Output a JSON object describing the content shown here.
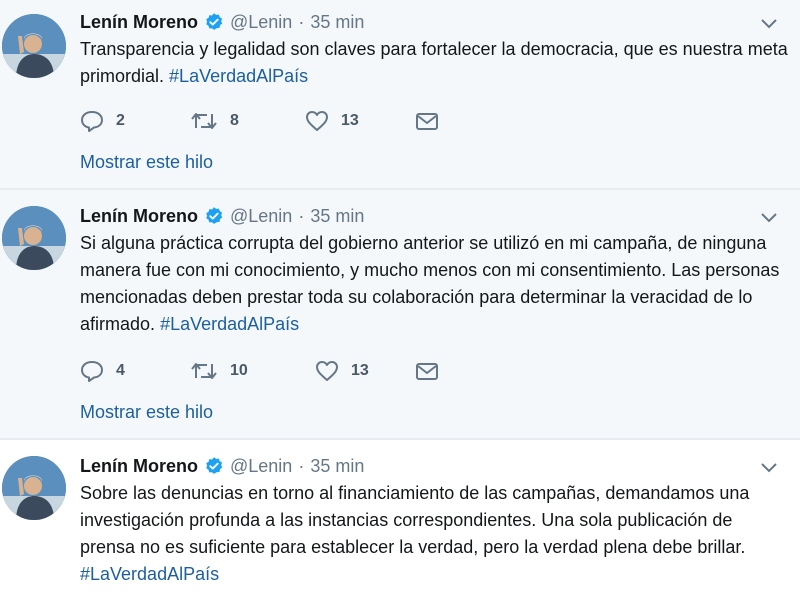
{
  "tweets": [
    {
      "name": "Lenín Moreno",
      "handle": "@Lenin",
      "separator": "·",
      "time": "35 min",
      "text": "Transparencia y legalidad son claves para fortalecer la democracia, que es nuestra meta primordial.",
      "hashtag": "#LaVerdadAlPaís",
      "replies": "2",
      "retweets": "8",
      "likes": "13",
      "thread_label": "Mostrar este hilo"
    },
    {
      "name": "Lenín Moreno",
      "handle": "@Lenin",
      "separator": "·",
      "time": "35 min",
      "text": "Si alguna práctica corrupta del gobierno anterior se utilizó en mi campaña, de ninguna manera fue con mi conocimiento, y mucho menos con mi consentimiento. Las personas mencionadas deben prestar toda su colaboración para determinar la veracidad de lo afirmado.",
      "hashtag": "#LaVerdadAlPaís",
      "replies": "4",
      "retweets": "10",
      "likes": "13",
      "thread_label": "Mostrar este hilo"
    },
    {
      "name": "Lenín Moreno",
      "handle": "@Lenin",
      "separator": "·",
      "time": "35 min",
      "text": "Sobre las denuncias en torno al financiamiento de las campañas, demandamos una investigación profunda a las instancias correspondientes. Una sola publicación de prensa no es suficiente para establecer la verdad, pero la verdad plena debe brillar.",
      "hashtag": "#LaVerdadAlPaís"
    }
  ],
  "icons": {
    "reply": "reply-icon",
    "retweet": "retweet-icon",
    "like": "heart-icon",
    "message": "envelope-icon",
    "verified": "verified-badge-icon",
    "menu": "chevron-down-icon"
  },
  "colors": {
    "link": "#1b5f9e",
    "verified": "#1da1f2",
    "muted": "#657786",
    "text": "#14171a"
  }
}
